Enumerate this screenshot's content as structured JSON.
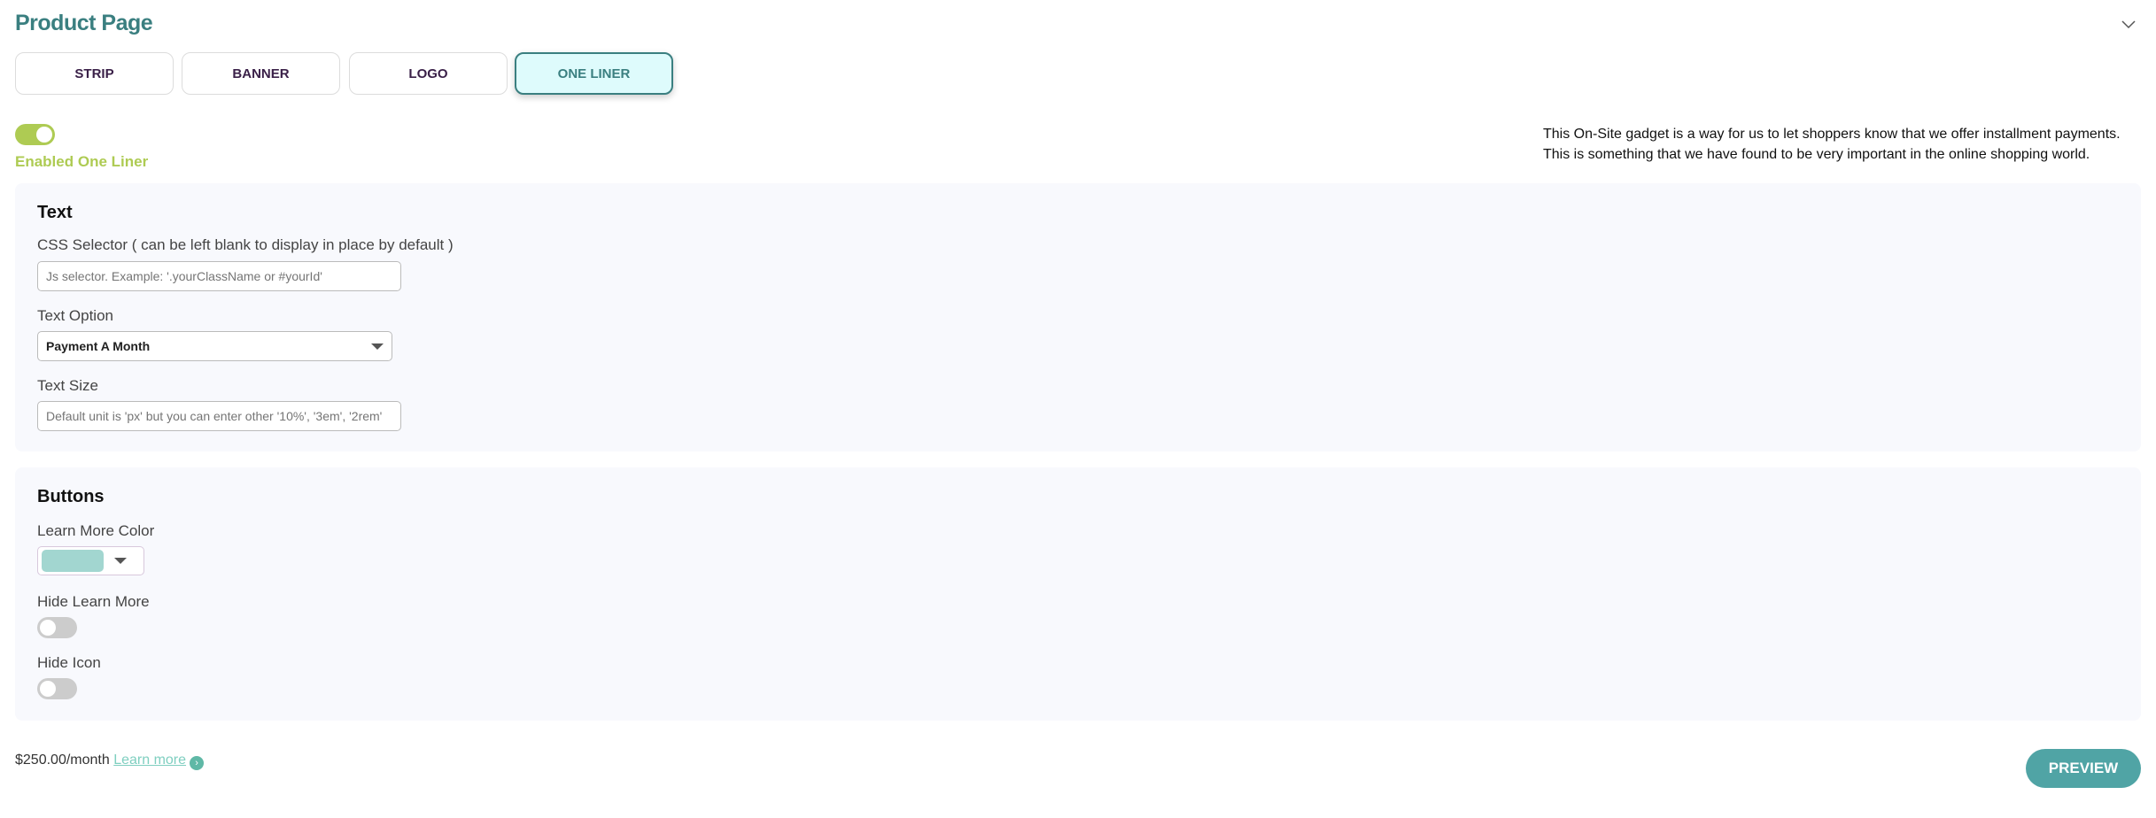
{
  "header": {
    "title": "Product Page",
    "collapse_icon": "chevron-down-icon"
  },
  "tabs": [
    {
      "label": "STRIP",
      "active": false
    },
    {
      "label": "BANNER",
      "active": false
    },
    {
      "label": "LOGO",
      "active": false
    },
    {
      "label": "ONE LINER",
      "active": true
    }
  ],
  "enable": {
    "label": "Enabled One Liner",
    "on": true,
    "color": "#aecb53"
  },
  "description": {
    "line1": "This On-Site gadget is a way for us to let shoppers know that we offer installment payments.",
    "line2": "This is something that we have found to be very important in the online shopping world."
  },
  "text_section": {
    "heading": "Text",
    "css_selector": {
      "label": "CSS Selector ( can be left blank to display in place by default )",
      "placeholder": "Js selector. Example: '.yourClassName or #yourId'",
      "value": ""
    },
    "text_option": {
      "label": "Text Option",
      "value": "Payment A Month"
    },
    "text_size": {
      "label": "Text Size",
      "placeholder": "Default unit is 'px' but you can enter other '10%', '3em', '2rem'",
      "value": ""
    }
  },
  "buttons_section": {
    "heading": "Buttons",
    "learn_more_color": {
      "label": "Learn More Color",
      "value": "#a2d6d0"
    },
    "hide_learn_more": {
      "label": "Hide Learn More",
      "on": false
    },
    "hide_icon": {
      "label": "Hide Icon",
      "on": false
    }
  },
  "preview": {
    "price": "$250.00/month",
    "link": "Learn more",
    "arrow_icon": "chevron-right-circle-icon"
  },
  "preview_button": "PREVIEW",
  "colors": {
    "accent": "#3a7f80",
    "button": "#50a4a5"
  }
}
